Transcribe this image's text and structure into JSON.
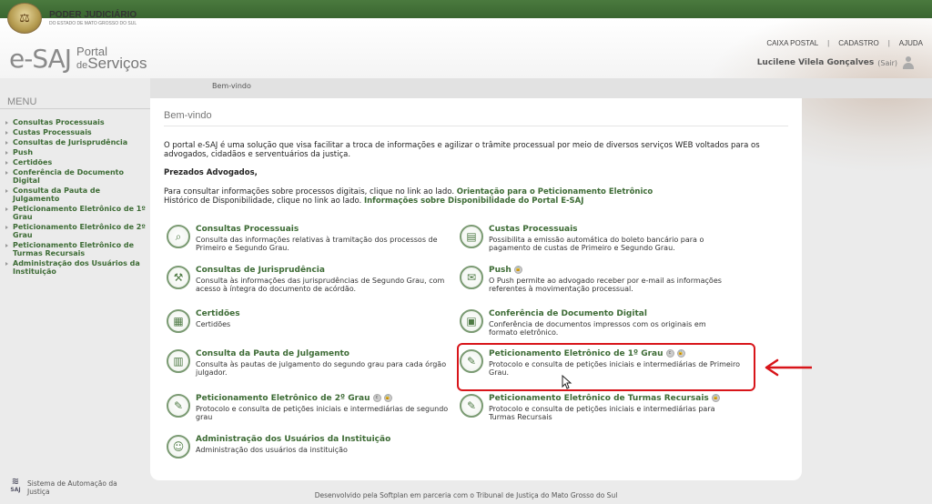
{
  "header": {
    "brand_title": "PODER JUDICIÁRIO",
    "brand_sub": "DO ESTADO DE MATO GROSSO DO SUL",
    "logo_main": "e-SAJ",
    "logo_portal": "Portal",
    "logo_de": "de",
    "logo_servicos": "Serviços",
    "links": [
      "CAIXA POSTAL",
      "CADASTRO",
      "AJUDA"
    ],
    "user_name": "Lucilene Vilela Gonçalves",
    "logout": "(Sair)"
  },
  "breadcrumb": "Bem-vindo",
  "sidebar": {
    "title": "MENU",
    "items": [
      "Consultas Processuais",
      "Custas Processuais",
      "Consultas de Jurisprudência",
      "Push",
      "Certidões",
      "Conferência de Documento Digital",
      "Consulta da Pauta de Julgamento",
      "Peticionamento Eletrônico de 1º Grau",
      "Peticionamento Eletrônico de 2º Grau",
      "Peticionamento Eletrônico de Turmas Recursais",
      "Administração dos Usuários da Instituição"
    ]
  },
  "main": {
    "title": "Bem-vindo",
    "intro": "O portal e-SAJ é uma solução que visa facilitar a troca de informações e agilizar o trâmite processual por meio de diversos serviços WEB voltados para os advogados, cidadãos e serventuários da justiça.",
    "greeting": "Prezados Advogados,",
    "consult_line1": "Para consultar informações sobre processos digitais, clique no link ao lado.",
    "consult_link1": "Orientação para o Peticionamento Eletrônico",
    "consult_line2": "Histórico de Disponibilidade, clique no link ao lado.",
    "consult_link2": "Informações sobre Disponibilidade do Portal E-SAJ",
    "services": [
      {
        "title": "Consultas Processuais",
        "desc": "Consulta das informações relativas à tramitação dos processos de Primeiro e Segundo Grau.",
        "icon": "search-icon"
      },
      {
        "title": "Custas Processuais",
        "desc": "Possibilita a emissão automática do boleto bancário para o pagamento de custas de Primeiro e Segundo Grau.",
        "icon": "invoice-icon"
      },
      {
        "title": "Consultas de Jurisprudência",
        "desc": "Consulta às informações das jurisprudências de Segundo Grau, com acesso à íntegra do documento de acórdão.",
        "icon": "gavel-icon"
      },
      {
        "title": "Push",
        "desc": "O Push permite ao advogado receber por e-mail as informações referentes à movimentação processual.",
        "icon": "push-icon"
      },
      {
        "title": "Certidões",
        "desc": "Certidões",
        "icon": "certificate-icon"
      },
      {
        "title": "Conferência de Documento Digital",
        "desc": "Conferência de documentos impressos com os originais em formato eletrônico.",
        "icon": "document-check-icon"
      },
      {
        "title": "Consulta da Pauta de Julgamento",
        "desc": "Consulta às pautas de julgamento do segundo grau para cada órgão julgador.",
        "icon": "calendar-icon"
      },
      {
        "title": "Peticionamento Eletrônico de 1º Grau",
        "desc": "Protocolo e consulta de petições iniciais e intermediárias de Primeiro Grau.",
        "icon": "petition-icon"
      },
      {
        "title": "Peticionamento Eletrônico de 2º Grau",
        "desc": "Protocolo e consulta de petições iniciais e intermediárias de segundo grau",
        "icon": "petition-icon"
      },
      {
        "title": "Peticionamento Eletrônico de Turmas Recursais",
        "desc": "Protocolo e consulta de petições iniciais e intermediárias para Turmas Recursais",
        "icon": "petition-icon"
      },
      {
        "title": "Administração dos Usuários da Instituição",
        "desc": "Administração dos usuários da instituição",
        "icon": "user-admin-icon"
      }
    ]
  },
  "footer": {
    "left_mark": "SAJ",
    "left": "Sistema de Automação da Justiça",
    "center": "Desenvolvido pela Softplan em parceria com o Tribunal de Justiça do Mato Grosso do Sul"
  },
  "colors": {
    "brand_green": "#3d6b35",
    "top_bar": "#4a7a3e",
    "highlight": "#d8151a"
  }
}
